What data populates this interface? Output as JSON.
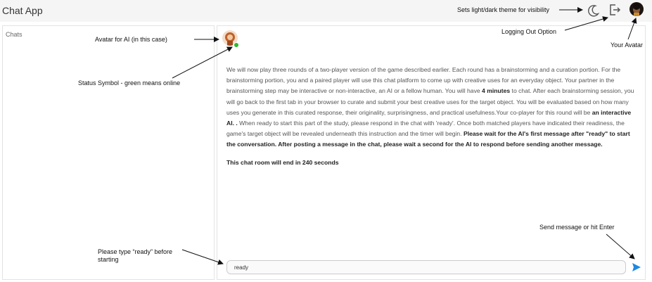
{
  "app": {
    "title": "Chat App"
  },
  "sidebar": {
    "heading": "Chats"
  },
  "message": {
    "p1": "We will now play three rounds of a two-player version of the game described earlier. Each round has a brainstorming and a curation portion. For the brainstorming portion, you and a paired player will use this chat platform to come up with creative uses for an everyday object. Your partner in the brainstorming step may be interactive or non-interactive, an AI or a fellow human. You will have ",
    "p1_bold": "4 minutes",
    "p2": " to chat. After each brainstorming session, you will go back to the first tab in your browser to curate and submit your best creative uses for the target object. You will be evaluated based on how many uses you generate in this curated response, their originality, surprisingness, and practical usefulness.Your co-player for this round will be ",
    "p2_bold": "an interactive AI. .",
    "p3": " When ready to start this part of the study, please respond in the chat with 'ready'. Once both matched players have indicated their readiness, the game's target object will be revealed underneath this instruction and the timer will begin. ",
    "p3_bold": "Please wait for the AI's first message after \"ready\" to start the conversation. After posting a message in the chat, please wait a second for the AI to respond before sending another message.",
    "countdown": "This chat room will end in 240 seconds"
  },
  "composer": {
    "value": "ready"
  },
  "annotations": {
    "theme": "Sets light/dark theme for visibility",
    "logout": "Logging Out Option",
    "your_avatar": "Your Avatar",
    "ai_avatar": "Avatar for AI (in this case)",
    "status": "Status Symbol - green means online",
    "ready": "Please type “ready” before starting",
    "send": "Send message or hit Enter"
  },
  "icons": {
    "theme": "moon-icon",
    "logout": "logout-icon",
    "user_avatar": "user-avatar",
    "ai_avatar": "ai-avatar",
    "status": "status-dot",
    "send": "send-icon"
  },
  "colors": {
    "status_online": "#2eb82e",
    "send": "#1e88e5"
  }
}
